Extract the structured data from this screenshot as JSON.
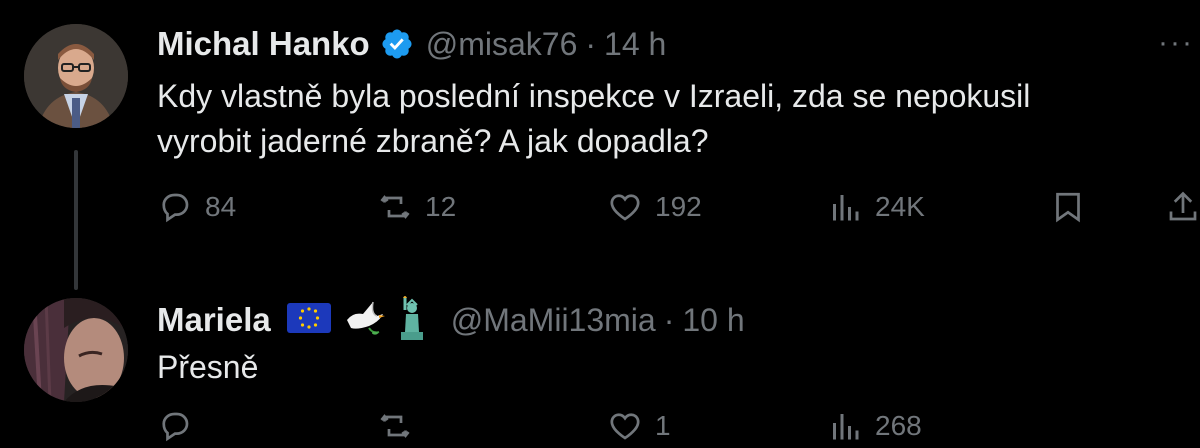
{
  "tweets": [
    {
      "name": "Michal Hanko",
      "handle": "@misak76",
      "separator": "·",
      "time": "14 h",
      "text_line1": "Kdy vlastně byla poslední inspekce v Izraeli, zda se nepokusil",
      "text_line2": "vyrobit jaderné zbraně? A jak dopadla?",
      "verified": true,
      "replies": "84",
      "reposts": "12",
      "likes": "192",
      "views": "24K"
    },
    {
      "name": "Mariela",
      "emoji": [
        "eu-flag-icon",
        "dove-icon",
        "statue-of-liberty-icon"
      ],
      "handle": "@MaMii13mia",
      "separator": "·",
      "time": "10 h",
      "text": "Přesně",
      "replies": "",
      "reposts": "",
      "likes": "1",
      "views": "268"
    }
  ],
  "colors": {
    "background": "#000000",
    "text": "#e7e9ea",
    "muted": "#71767b",
    "verified": "#1d9bf0"
  },
  "more_label": "···"
}
